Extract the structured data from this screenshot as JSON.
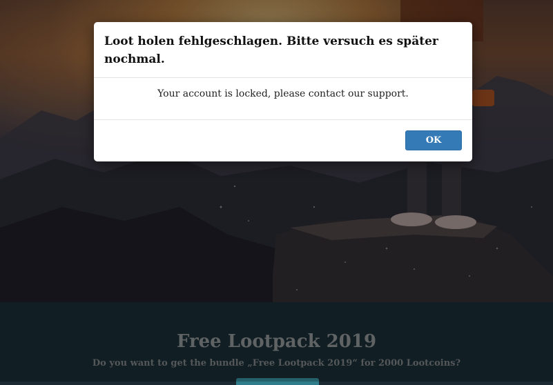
{
  "dialog": {
    "title": "Loot holen fehlgeschlagen. Bitte versuch es später nochmal.",
    "message": "Your account is locked, please contact our support.",
    "ok_label": "OK"
  },
  "offer": {
    "title": "Free Lootpack 2019",
    "subtitle": "Do you want to get the bundle „Free Lootpack 2019“ for 2000 Lootcoins?"
  },
  "colors": {
    "primary_button": "#337ab7",
    "lower_background": "#16272f",
    "dialog_background": "#ffffff"
  }
}
